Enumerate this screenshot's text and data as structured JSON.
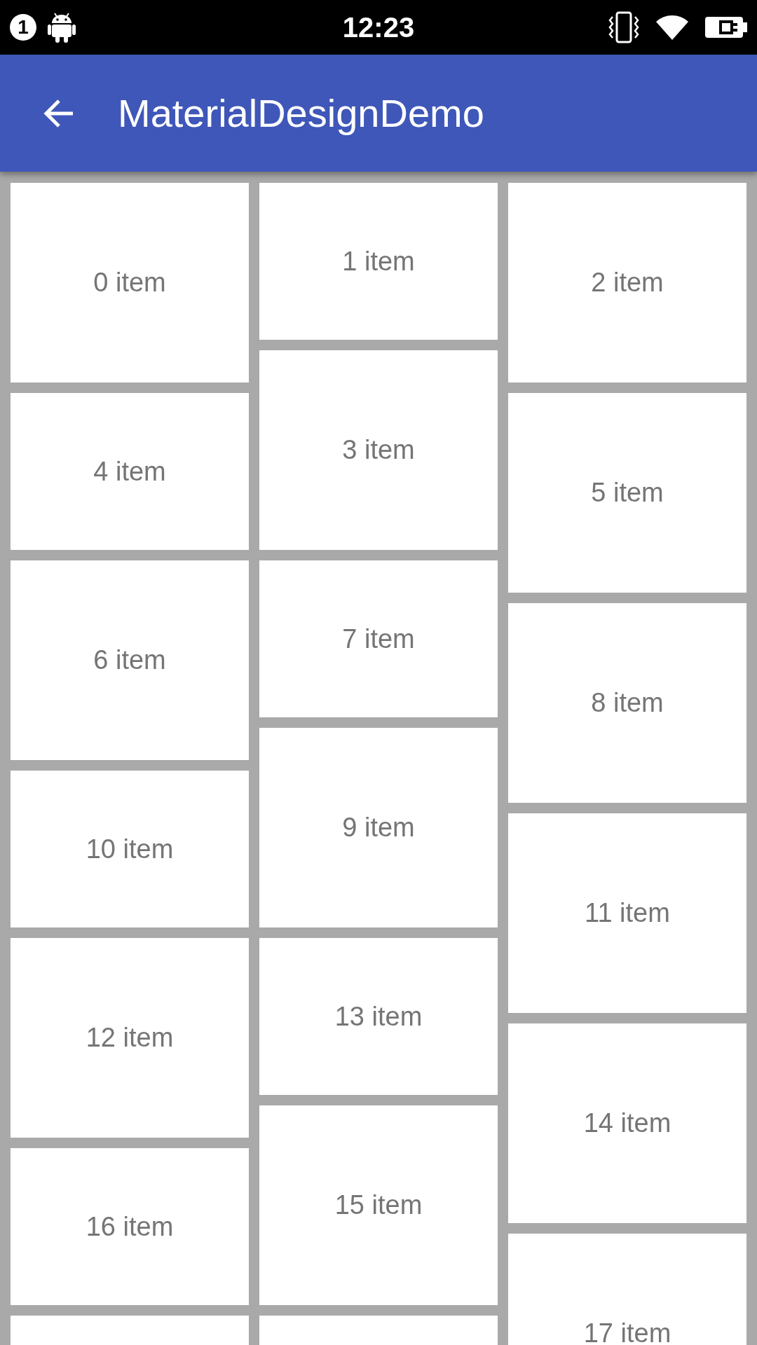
{
  "status_bar": {
    "notification_count": "1",
    "time": "12:23"
  },
  "app_bar": {
    "title": "MaterialDesignDemo"
  },
  "columns": [
    {
      "items": [
        {
          "label": "0 item",
          "kind": "tall"
        },
        {
          "label": "4 item",
          "kind": "short"
        },
        {
          "label": "6 item",
          "kind": "tall"
        },
        {
          "label": "10 item",
          "kind": "short"
        },
        {
          "label": "12 item",
          "kind": "tall"
        },
        {
          "label": "16 item",
          "kind": "short"
        },
        {
          "kind": "tall"
        }
      ]
    },
    {
      "items": [
        {
          "label": "1 item",
          "kind": "short"
        },
        {
          "label": "3 item",
          "kind": "tall"
        },
        {
          "label": "7 item",
          "kind": "short"
        },
        {
          "label": "9 item",
          "kind": "tall"
        },
        {
          "label": "13 item",
          "kind": "short"
        },
        {
          "label": "15 item",
          "kind": "tall"
        },
        {
          "kind": "short"
        }
      ]
    },
    {
      "items": [
        {
          "label": "2 item",
          "kind": "tall"
        },
        {
          "label": "5 item",
          "kind": "tall"
        },
        {
          "label": "8 item",
          "kind": "tall"
        },
        {
          "label": "11 item",
          "kind": "tall"
        },
        {
          "label": "14 item",
          "kind": "tall"
        },
        {
          "label": "17 item",
          "kind": "tall"
        }
      ]
    }
  ]
}
